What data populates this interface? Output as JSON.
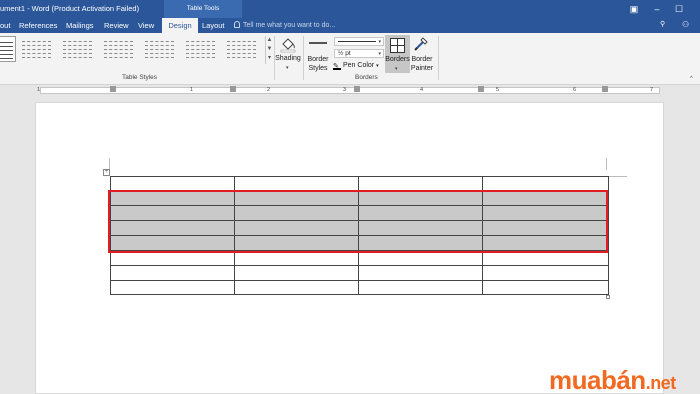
{
  "window": {
    "title": "ument1 - Word (Product Activation Failed)",
    "context_tab_title": "Table Tools"
  },
  "tabs": [
    {
      "label": "out"
    },
    {
      "label": "References"
    },
    {
      "label": "Mailings"
    },
    {
      "label": "Review"
    },
    {
      "label": "View"
    },
    {
      "label": "Design",
      "active": true
    },
    {
      "label": "Layout"
    }
  ],
  "tell_me": {
    "placeholder": "Tell me what you want to do..."
  },
  "ribbon": {
    "table_styles": {
      "group_label": "Table Styles",
      "count": 7
    },
    "shading": {
      "label": "Shading"
    },
    "border_styles": {
      "label": "Border Styles"
    },
    "line_weight": {
      "value": "½ pt"
    },
    "pen_color": {
      "label": "Pen Color"
    },
    "borders": {
      "label": "Borders"
    },
    "border_painter": {
      "label": "Border Painter"
    },
    "borders_group_label": "Borders"
  },
  "ruler": {
    "numbers": [
      "1",
      "1",
      "2",
      "3",
      "4",
      "5",
      "6",
      "7"
    ]
  },
  "table": {
    "rows": 8,
    "columns": 4,
    "selected_rows": [
      1,
      2,
      3,
      4
    ]
  },
  "watermark": {
    "text": "muabán",
    "suffix": ".net"
  },
  "colors": {
    "word_blue": "#2b579a",
    "selection_gray": "#c9c9c9",
    "highlight_red": "#e31b23",
    "watermark_orange": "#f26a21"
  }
}
